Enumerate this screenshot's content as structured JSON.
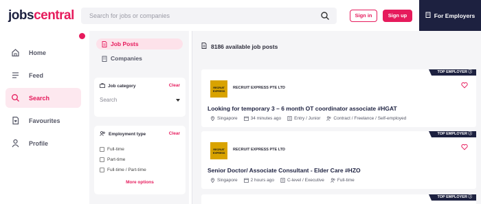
{
  "header": {
    "logo_part1": "jobs",
    "logo_part2": "central",
    "search_placeholder": "Search for jobs or companies",
    "sign_in": "Sign in",
    "sign_up": "Sign up",
    "for_employers": "For Employers"
  },
  "nav": {
    "badge_count": "",
    "items": [
      {
        "label": "Home",
        "icon": "home-icon"
      },
      {
        "label": "Feed",
        "icon": "feed-icon"
      },
      {
        "label": "Search",
        "icon": "search-icon"
      },
      {
        "label": "Favourites",
        "icon": "favourites-icon"
      },
      {
        "label": "Profile",
        "icon": "profile-icon"
      }
    ]
  },
  "filters": {
    "tab_jobs": "Job Posts",
    "tab_companies": "Companies",
    "category": {
      "title": "Job category",
      "clear": "Clear",
      "placeholder": "Search"
    },
    "employment": {
      "title": "Employment type",
      "clear": "Clear",
      "options": [
        "Full-time",
        "Part-time",
        "Full-time / Part-time"
      ],
      "more": "More options"
    }
  },
  "results": {
    "count_text": "8186 available job posts",
    "badge": "TOP EMPLOYER",
    "jobs": [
      {
        "company": "RECRUIT EXPRESS PTE LTD",
        "logo_text": "RECRUIT EXPRESS",
        "title": "Looking for temporary 3 – 6 month OT coordinator associate #HGAT",
        "location": "Singapore",
        "posted": "34 minutes ago",
        "level": "Entry / Junior",
        "type": "Contract / Freelance / Self-employed"
      },
      {
        "company": "RECRUIT EXPRESS PTE LTD",
        "logo_text": "RECRUIT EXPRESS",
        "title": "Senior Doctor/ Associate Consultant - Elder Care #HZO",
        "location": "Singapore",
        "posted": "2 hours ago",
        "level": "C-level / Executive",
        "type": "Full-time"
      }
    ]
  },
  "colors": {
    "accent": "#e61b5c",
    "navy": "#1d2140",
    "panel_bg": "#f5f5f7",
    "logo_gold": "#d9a300"
  }
}
